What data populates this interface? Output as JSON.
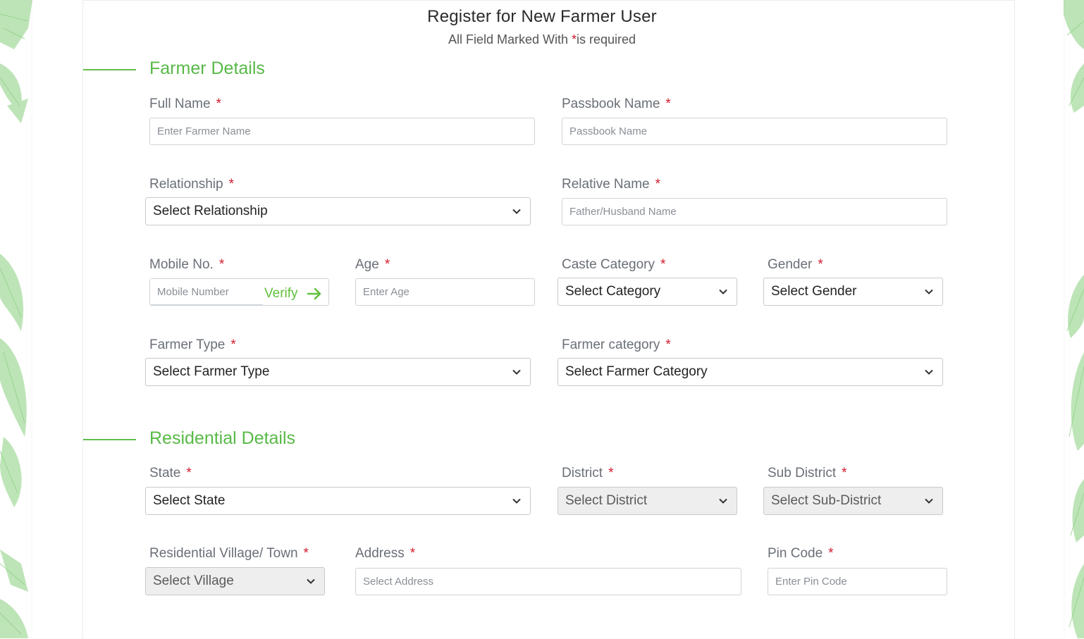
{
  "header": {
    "title": "Register for New Farmer User",
    "subtitle_prefix": "All Field Marked With ",
    "subtitle_star": "*",
    "subtitle_suffix": "is required"
  },
  "colors": {
    "accent_green": "#58b947",
    "required_red": "#d11a2a",
    "disabled_bg": "#eeeeee"
  },
  "required_mark": "*",
  "farmer_details": {
    "title": "Farmer Details",
    "full_name": {
      "label": "Full Name",
      "placeholder": "Enter Farmer Name",
      "value": ""
    },
    "passbook_name": {
      "label": "Passbook Name",
      "placeholder": "Passbook Name",
      "value": ""
    },
    "relationship": {
      "label": "Relationship",
      "selected": "Select Relationship"
    },
    "relative_name": {
      "label": "Relative Name",
      "placeholder": "Father/Husband Name",
      "value": ""
    },
    "mobile": {
      "label": "Mobile No.",
      "placeholder": "Mobile Number",
      "value": "",
      "verify_label": "Verify"
    },
    "age": {
      "label": "Age",
      "placeholder": "Enter Age",
      "value": ""
    },
    "caste_category": {
      "label": "Caste Category",
      "selected": "Select Category"
    },
    "gender": {
      "label": "Gender",
      "selected": "Select Gender"
    },
    "farmer_type": {
      "label": "Farmer Type",
      "selected": "Select Farmer Type"
    },
    "farmer_category": {
      "label": "Farmer category",
      "selected": "Select Farmer Category"
    }
  },
  "residential_details": {
    "title": "Residential Details",
    "state": {
      "label": "State",
      "selected": "Select State"
    },
    "district": {
      "label": "District",
      "selected": "Select District"
    },
    "sub_district": {
      "label": "Sub District",
      "selected": "Select Sub-District"
    },
    "village": {
      "label": "Residential Village/ Town",
      "selected": "Select Village"
    },
    "address": {
      "label": "Address",
      "placeholder": "Select Address",
      "value": ""
    },
    "pin_code": {
      "label": "Pin Code",
      "placeholder": "Enter Pin Code",
      "value": ""
    }
  }
}
